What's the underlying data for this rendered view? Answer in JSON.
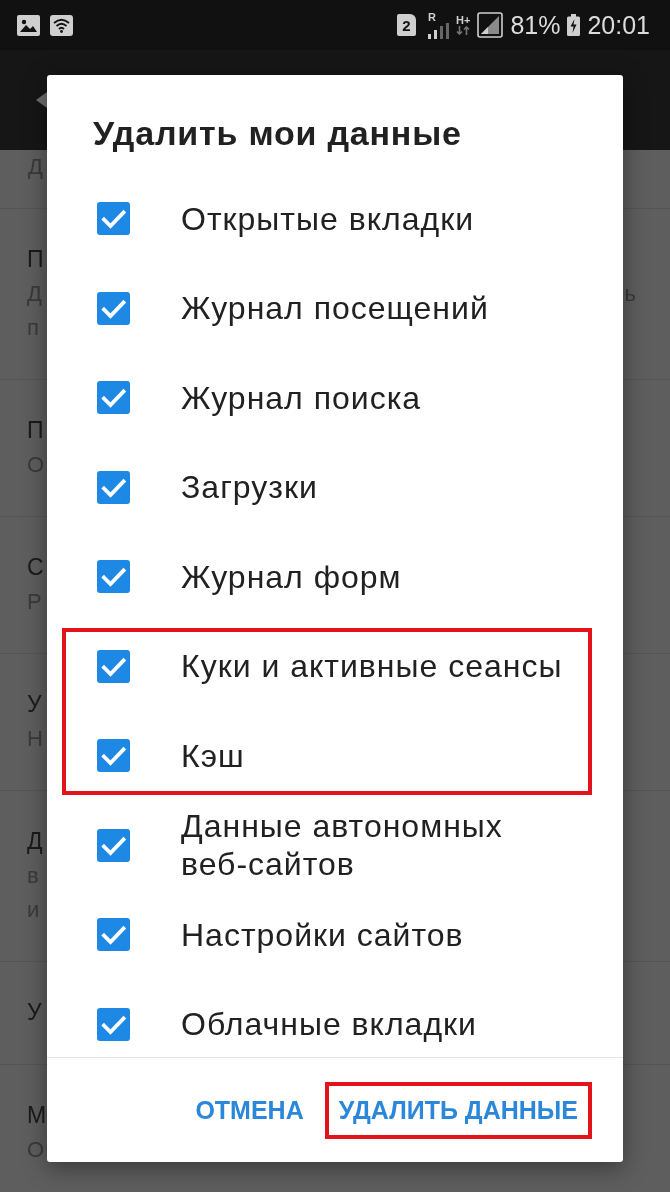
{
  "status_bar": {
    "sim_slot": "2",
    "roaming": "R",
    "network_type": "H+",
    "battery": "81%",
    "time": "20:01"
  },
  "background_list": [
    {
      "subtitle_lines": [
        {
          "start": "Д"
        }
      ]
    },
    {
      "title": "П",
      "subtitle_lines": [
        {
          "start": "Д",
          "end": "ь"
        },
        {
          "start": "п"
        }
      ]
    },
    {
      "title": "П",
      "subtitle_lines": [
        {
          "start": "О"
        }
      ]
    },
    {
      "title": "С",
      "subtitle_lines": [
        {
          "start": "Р"
        }
      ]
    },
    {
      "title": "У",
      "subtitle_lines": [
        {
          "start": "Н"
        }
      ]
    },
    {
      "title": "Д",
      "subtitle_lines": [
        {
          "start": "в"
        },
        {
          "start": "и"
        }
      ]
    },
    {
      "title": "У"
    },
    {
      "title": "М",
      "subtitle_lines": [
        {
          "start": "О"
        }
      ]
    }
  ],
  "dialog": {
    "title": "Удалить мои данные",
    "options": [
      {
        "label": "Открытые вкладки",
        "checked": true,
        "highlighted": false
      },
      {
        "label": "Журнал посещений",
        "checked": true,
        "highlighted": false
      },
      {
        "label": "Журнал поиска",
        "checked": true,
        "highlighted": false
      },
      {
        "label": "Загрузки",
        "checked": true,
        "highlighted": false
      },
      {
        "label": "Журнал форм",
        "checked": true,
        "highlighted": false
      },
      {
        "label": "Куки и активные сеансы",
        "checked": true,
        "highlighted": true
      },
      {
        "label": "Кэш",
        "checked": true,
        "highlighted": true
      },
      {
        "label": "Данные автономных веб-сайтов",
        "checked": true,
        "highlighted": false
      },
      {
        "label": "Настройки сайтов",
        "checked": true,
        "highlighted": false
      },
      {
        "label": "Облачные вкладки",
        "checked": true,
        "highlighted": false
      }
    ],
    "buttons": [
      {
        "label": "ОТМЕНА",
        "highlighted": false
      },
      {
        "label": "УДАЛИТЬ ДАННЫЕ",
        "highlighted": true
      }
    ]
  }
}
